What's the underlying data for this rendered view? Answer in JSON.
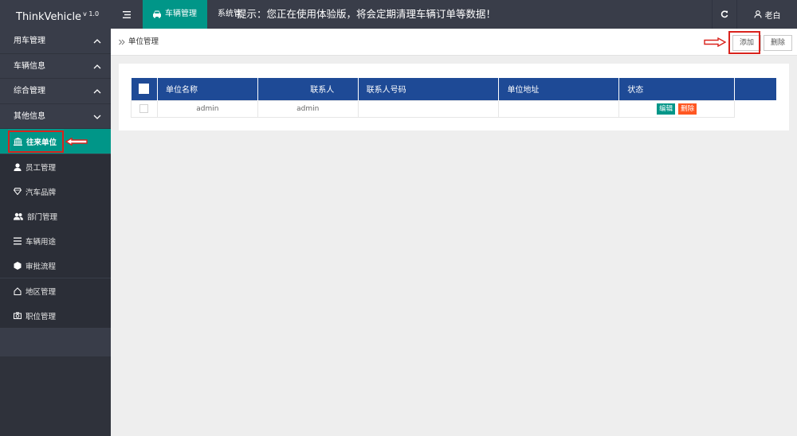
{
  "app": {
    "name": "ThinkVehicle",
    "version": "v 1.0"
  },
  "topbar": {
    "active_tab": "车辆管理",
    "sys_tab": "系统管",
    "notice": "提示：您正在使用体验版，将会定期清理车辆订单等数据！",
    "user": "老白"
  },
  "sidebar": {
    "groups": [
      "用车管理",
      "车辆信息",
      "综合管理",
      "其他信息"
    ],
    "items": [
      {
        "label": "往来单位",
        "icon": "bank-icon"
      },
      {
        "label": "员工管理",
        "icon": "user-icon"
      },
      {
        "label": "汽车品牌",
        "icon": "diamond-icon"
      },
      {
        "label": "部门管理",
        "icon": "users-icon"
      },
      {
        "label": "车辆用途",
        "icon": "list-icon"
      },
      {
        "label": "审批流程",
        "icon": "cube-icon"
      },
      {
        "label": "地区管理",
        "icon": "home-icon"
      },
      {
        "label": "职位管理",
        "icon": "camera-icon"
      }
    ]
  },
  "breadcrumb": "单位管理",
  "actions": {
    "add": "添加",
    "delete": "删除"
  },
  "table": {
    "headers": [
      "单位名称",
      "联系人",
      "联系人号码",
      "单位地址",
      "状态"
    ],
    "rows": [
      {
        "name": "admin",
        "contact": "admin",
        "phone": "",
        "address": "",
        "edit": "编辑",
        "delete": "删除"
      }
    ]
  },
  "colors": {
    "nav": "#393d49",
    "accent": "#009688",
    "header": "#1e4a96",
    "danger": "#ff5722",
    "highlight": "#d9231d"
  }
}
